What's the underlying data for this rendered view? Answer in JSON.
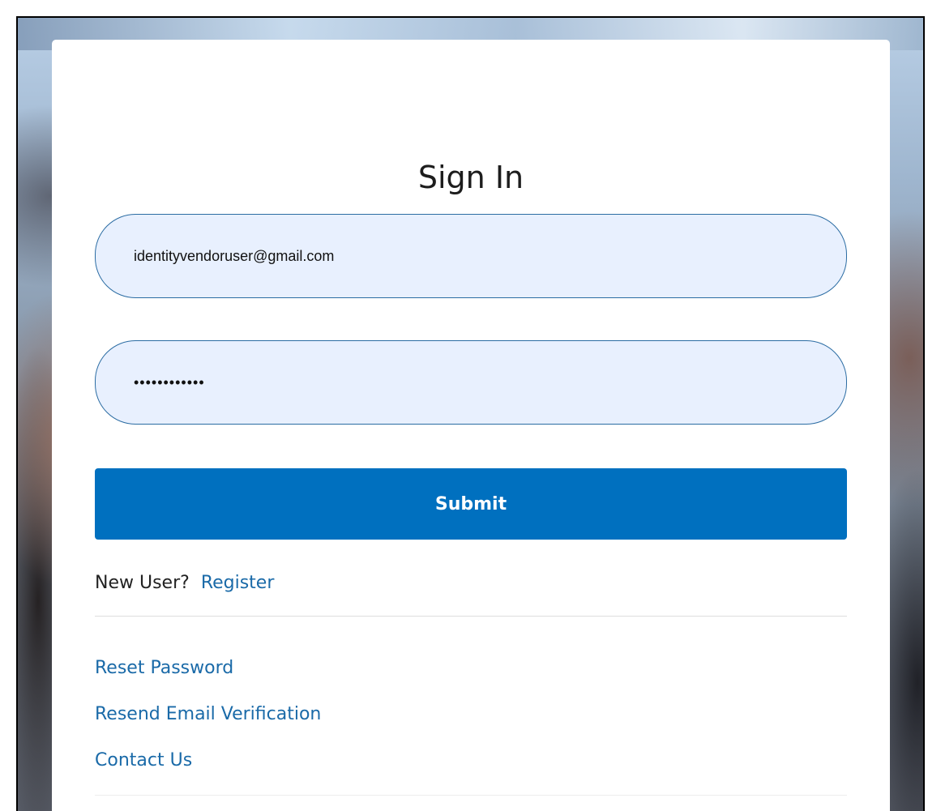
{
  "signin": {
    "title": "Sign In",
    "email_value": "identityvendoruser@gmail.com",
    "password_value": "passwordvalu",
    "submit_label": "Submit",
    "new_user_text": "New User?",
    "register_link": "Register",
    "links": [
      "Reset Password",
      "Resend Email Verification",
      "Contact Us"
    ]
  },
  "colors": {
    "accent": "#0070bf",
    "link": "#1a6aa8",
    "input_bg": "#e8f0fe",
    "input_border": "#2b6ca3"
  }
}
